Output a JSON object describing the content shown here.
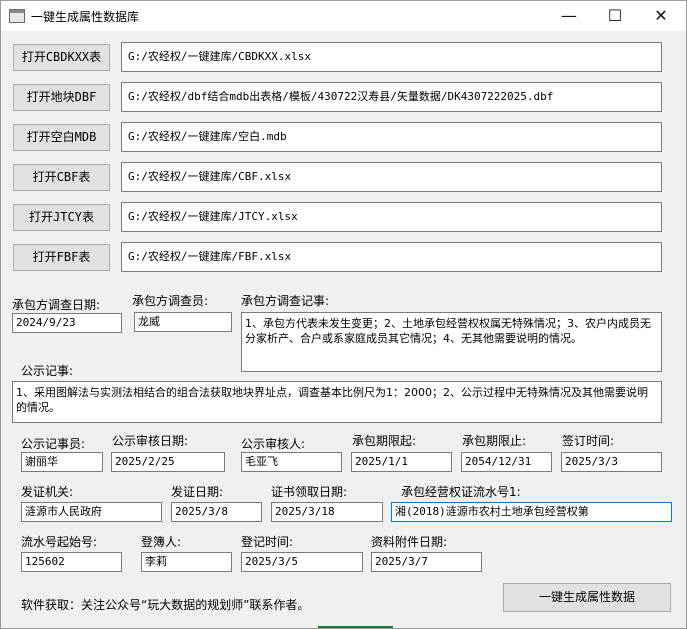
{
  "window": {
    "title": "一键生成属性数据库"
  },
  "controls": {
    "minimize": "—",
    "maximize": "☐",
    "close": "✕"
  },
  "files": [
    {
      "button": "打开CBDKXX表",
      "path": "G:/农经权/一键建库/CBDKXX.xlsx"
    },
    {
      "button": "打开地块DBF",
      "path": "G:/农经权/dbf结合mdb出表格/模板/430722汉寿县/矢量数据/DK4307222025.dbf"
    },
    {
      "button": "打开空白MDB",
      "path": "G:/农经权/一键建库/空白.mdb"
    },
    {
      "button": "打开CBF表",
      "path": "G:/农经权/一键建库/CBF.xlsx"
    },
    {
      "button": "打开JTCY表",
      "path": "G:/农经权/一键建库/JTCY.xlsx"
    },
    {
      "button": "打开FBF表",
      "path": "G:/农经权/一键建库/FBF.xlsx"
    }
  ],
  "survey": {
    "date_label": "承包方调查日期:",
    "date_value": "2024/9/23",
    "investigator_label": "承包方调查员:",
    "investigator_value": "龙威",
    "notes_label": "承包方调查记事:",
    "notes_value": "1、承包方代表未发生变更；2、土地承包经营权权属无特殊情况；3、农户内成员无分家析产、合户或系家庭成员其它情况；4、无其他需要说明的情况。"
  },
  "publicity": {
    "notes_label": "公示记事:",
    "notes_value": "1、采用图解法与实测法相结合的组合法获取地块界址点，调查基本比例尺为1：2000；2、公示过程中无特殊情况及其他需要说明的情况。"
  },
  "row1": [
    {
      "label": "公示记事员:",
      "value": "谢丽华"
    },
    {
      "label": "公示审核日期:",
      "value": "2025/2/25"
    },
    {
      "label": "公示审核人:",
      "value": "毛亚飞"
    },
    {
      "label": "承包期限起:",
      "value": "2025/1/1"
    },
    {
      "label": "承包期限止:",
      "value": "2054/12/31"
    },
    {
      "label": "签订时间:",
      "value": "2025/3/3"
    }
  ],
  "row2": [
    {
      "label": "发证机关:",
      "value": "涟源市人民政府"
    },
    {
      "label": "发证日期:",
      "value": "2025/3/8"
    },
    {
      "label": "证书领取日期:",
      "value": "2025/3/18"
    },
    {
      "label": "承包经营权证流水号1:",
      "value": "湘(2018)涟源市农村土地承包经营权第"
    }
  ],
  "row3": [
    {
      "label": "流水号起始号:",
      "value": "125602"
    },
    {
      "label": "登簿人:",
      "value": "李莉"
    },
    {
      "label": "登记时间:",
      "value": "2025/3/5"
    },
    {
      "label": "资料附件日期:",
      "value": "2025/3/7"
    }
  ],
  "footer": {
    "note": "软件获取：关注公众号“玩大数据的规划师”联系作者。",
    "generate_button": "一键生成属性数据"
  }
}
